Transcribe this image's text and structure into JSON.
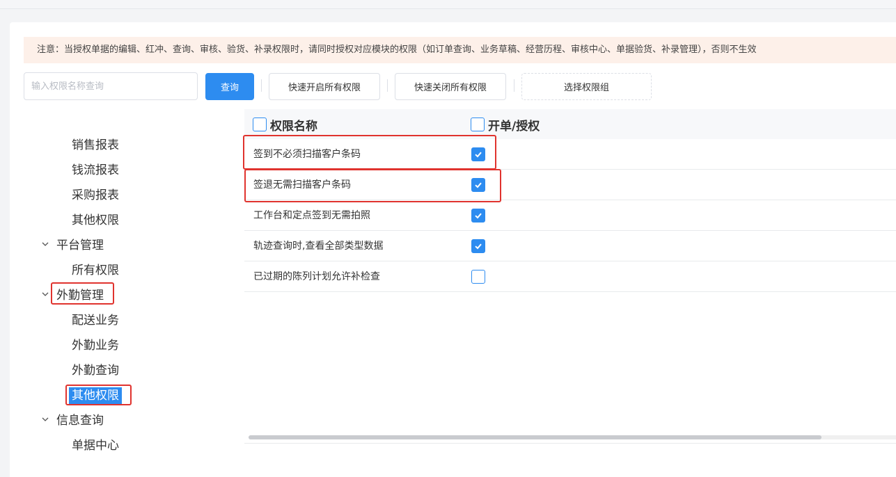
{
  "notice": "注意：当授权单据的编辑、红冲、查询、审核、验货、补录权限时，请同时授权对应模块的权限（如订单查询、业务草稿、经营历程、审核中心、单据验货、补录管理），否则不生效",
  "toolbar": {
    "search_placeholder": "输入权限名称查询",
    "search_label": "查询",
    "open_all_label": "快速开启所有权限",
    "close_all_label": "快速关闭所有权限",
    "select_group_label": "选择权限组"
  },
  "tree": {
    "items": [
      {
        "label": "销售报表"
      },
      {
        "label": "钱流报表"
      },
      {
        "label": "采购报表"
      },
      {
        "label": "其他权限"
      },
      {
        "label": "平台管理"
      },
      {
        "label": "所有权限"
      },
      {
        "label": "外勤管理"
      },
      {
        "label": "配送业务"
      },
      {
        "label": "外勤业务"
      },
      {
        "label": "外勤查询"
      },
      {
        "label": "其他权限"
      },
      {
        "label": "信息查询"
      },
      {
        "label": "单据中心"
      }
    ]
  },
  "table": {
    "columns": [
      "权限名称",
      "开单/授权"
    ],
    "rows": [
      {
        "name": "签到不必须扫描客户条码",
        "checked": true
      },
      {
        "name": "签退无需扫描客户条码",
        "checked": true
      },
      {
        "name": "工作台和定点签到无需拍照",
        "checked": true
      },
      {
        "name": "轨迹查询时,查看全部类型数据",
        "checked": true
      },
      {
        "name": "已过期的陈列计划允许补检查",
        "checked": false
      }
    ]
  },
  "colors": {
    "accent": "#2d8cf0",
    "highlight_box": "#e0332e",
    "notice_bg": "#fdf0e9"
  },
  "icons": {
    "expand": "chevron-down-icon",
    "check": "check-icon"
  }
}
